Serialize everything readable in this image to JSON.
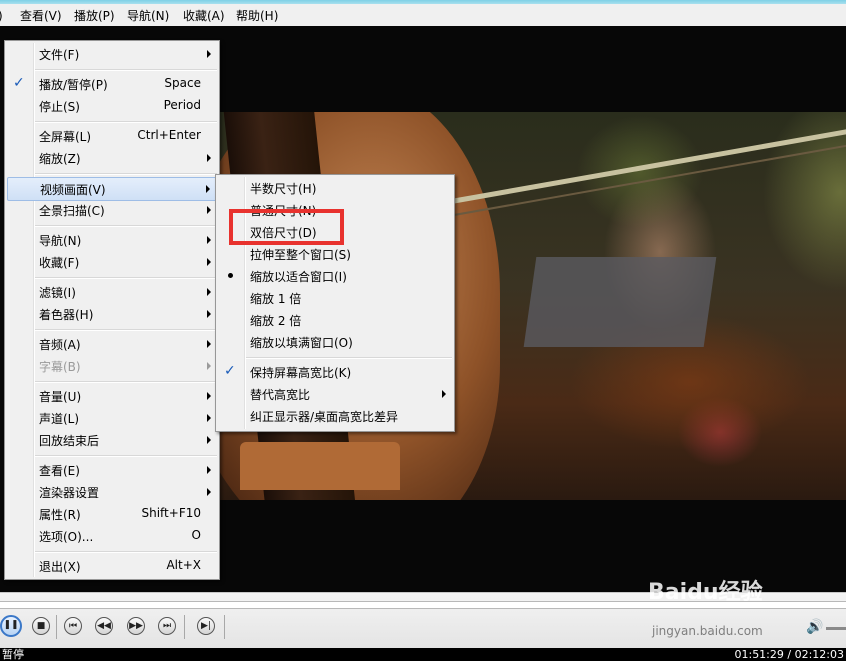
{
  "menubar": {
    "items": [
      {
        "label": ")"
      },
      {
        "label": "查看(V)"
      },
      {
        "label": "播放(P)"
      },
      {
        "label": "导航(N)"
      },
      {
        "label": "收藏(A)"
      },
      {
        "label": "帮助(H)"
      }
    ]
  },
  "main_menu": {
    "items": [
      {
        "label": "文件(F)",
        "submenu": true
      },
      {
        "label": "播放/暂停(P)",
        "shortcut": "Space",
        "checked": true
      },
      {
        "label": "停止(S)",
        "shortcut": "Period"
      },
      {
        "label": "全屏幕(L)",
        "shortcut": "Ctrl+Enter"
      },
      {
        "label": "缩放(Z)",
        "submenu": true
      },
      {
        "label": "视频画面(V)",
        "submenu": true,
        "highlighted": true
      },
      {
        "label": "全景扫描(C)",
        "submenu": true
      },
      {
        "label": "导航(N)",
        "submenu": true
      },
      {
        "label": "收藏(F)",
        "submenu": true
      },
      {
        "label": "滤镜(I)",
        "submenu": true
      },
      {
        "label": "着色器(H)",
        "submenu": true
      },
      {
        "label": "音频(A)",
        "submenu": true
      },
      {
        "label": "字幕(B)",
        "submenu": true,
        "disabled": true
      },
      {
        "label": "音量(U)",
        "submenu": true
      },
      {
        "label": "声道(L)",
        "submenu": true
      },
      {
        "label": "回放结束后",
        "submenu": true
      },
      {
        "label": "查看(E)",
        "submenu": true
      },
      {
        "label": "渲染器设置",
        "submenu": true
      },
      {
        "label": "属性(R)",
        "shortcut": "Shift+F10"
      },
      {
        "label": "选项(O)...",
        "shortcut": "O"
      },
      {
        "label": "退出(X)",
        "shortcut": "Alt+X"
      }
    ]
  },
  "video_submenu": {
    "items": [
      {
        "label": "半数尺寸(H)"
      },
      {
        "label": "普通尺寸(N)"
      },
      {
        "label": "双倍尺寸(D)",
        "annotated": true
      },
      {
        "label": "拉伸至整个窗口(S)"
      },
      {
        "label": "缩放以适合窗口(I)",
        "selected": true
      },
      {
        "label": "缩放 1 倍"
      },
      {
        "label": "缩放 2 倍"
      },
      {
        "label": "缩放以填满窗口(O)"
      },
      {
        "label": "保持屏幕高宽比(K)",
        "checked": true
      },
      {
        "label": "替代高宽比",
        "submenu": true
      },
      {
        "label": "纠正显示器/桌面高宽比差异"
      }
    ]
  },
  "controls": {
    "buttons": [
      {
        "icon": "pause-icon",
        "active": true
      },
      {
        "icon": "stop-icon"
      },
      {
        "icon": "skip-back-icon"
      },
      {
        "icon": "rewind-icon"
      },
      {
        "icon": "fast-forward-icon"
      },
      {
        "icon": "skip-forward-icon"
      },
      {
        "icon": "frame-step-icon"
      }
    ]
  },
  "status": {
    "text": "暂停",
    "time": "01:51:29 / 02:12:03"
  },
  "watermark": {
    "brand": "Baidu经验",
    "site": "jingyan.baidu.com"
  },
  "colors": {
    "highlight_box": "#e8322e",
    "check": "#1a5bb8",
    "menu_bg": "#f0f0f0"
  }
}
